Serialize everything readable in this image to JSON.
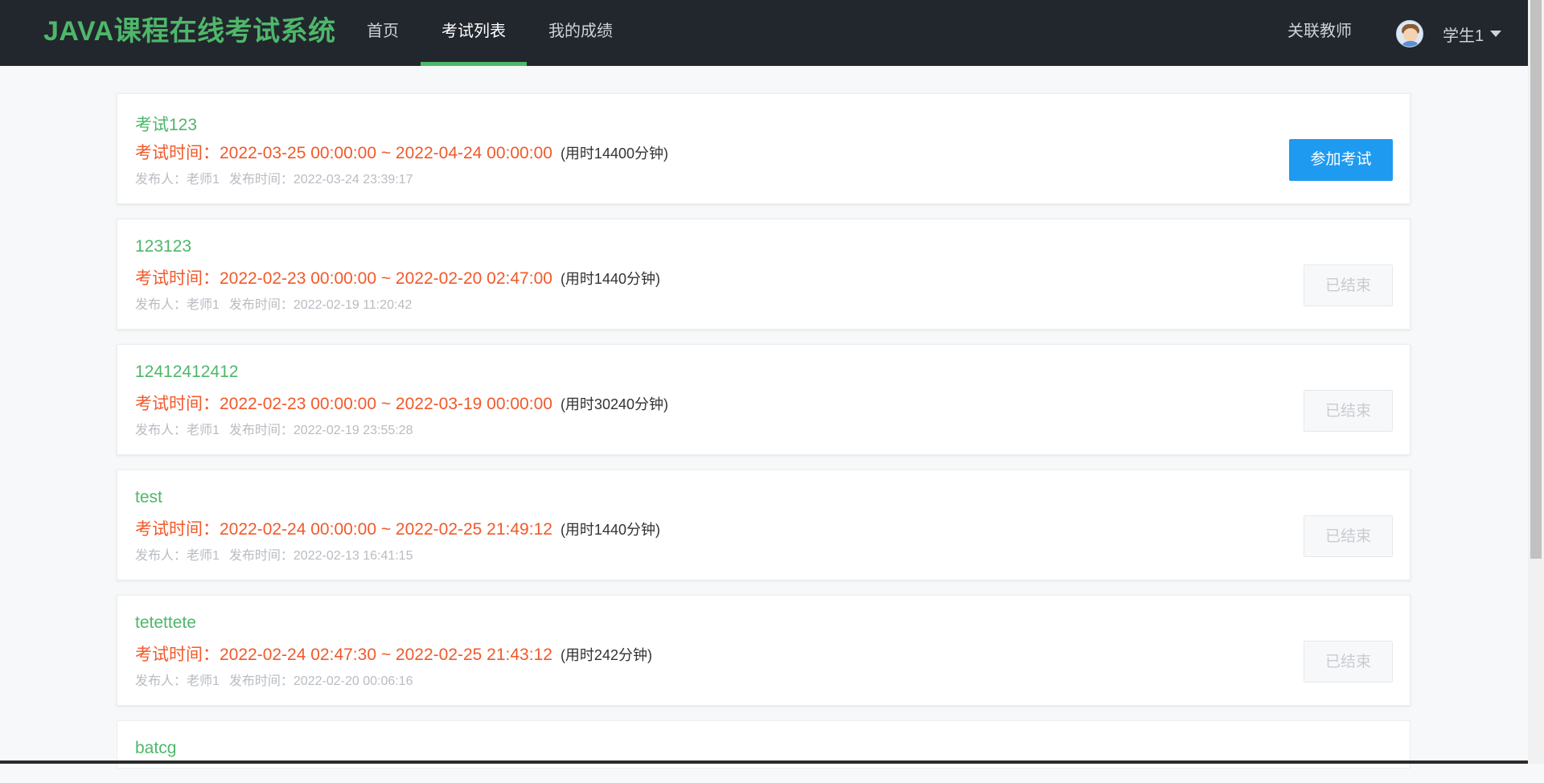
{
  "header": {
    "brand": "JAVA课程在线考试系统",
    "nav": [
      {
        "label": "首页"
      },
      {
        "label": "考试列表",
        "active": true
      },
      {
        "label": "我的成绩"
      }
    ],
    "link_teacher": "关联教师",
    "user_name": "学生1"
  },
  "colors": {
    "header_bg": "#22262d",
    "accent_green": "#4eb76a",
    "time_red": "#f1592a",
    "primary_blue": "#1e9bf1"
  },
  "exams": [
    {
      "title": "考试123",
      "time_label": "考试时间：2022-03-25 00:00:00 ~ 2022-04-24 00:00:00",
      "duration": "(用时14400分钟)",
      "publisher": "发布人：老师1",
      "publish_time": "发布时间：2022-03-24 23:39:17",
      "action": "参加考试"
    },
    {
      "title": "123123",
      "time_label": "考试时间：2022-02-23 00:00:00 ~ 2022-02-20 02:47:00",
      "duration": "(用时1440分钟)",
      "publisher": "发布人：老师1",
      "publish_time": "发布时间：2022-02-19 11:20:42",
      "action": "已结束"
    },
    {
      "title": "12412412412",
      "time_label": "考试时间：2022-02-23 00:00:00 ~ 2022-03-19 00:00:00",
      "duration": "(用时30240分钟)",
      "publisher": "发布人：老师1",
      "publish_time": "发布时间：2022-02-19 23:55:28",
      "action": "已结束"
    },
    {
      "title": "test",
      "time_label": "考试时间：2022-02-24 00:00:00 ~ 2022-02-25 21:49:12",
      "duration": "(用时1440分钟)",
      "publisher": "发布人：老师1",
      "publish_time": "发布时间：2022-02-13 16:41:15",
      "action": "已结束"
    },
    {
      "title": "tetettete",
      "time_label": "考试时间：2022-02-24 02:47:30 ~ 2022-02-25 21:43:12",
      "duration": "(用时242分钟)",
      "publisher": "发布人：老师1",
      "publish_time": "发布时间：2022-02-20 00:06:16",
      "action": "已结束"
    },
    {
      "title": "batcg"
    }
  ]
}
